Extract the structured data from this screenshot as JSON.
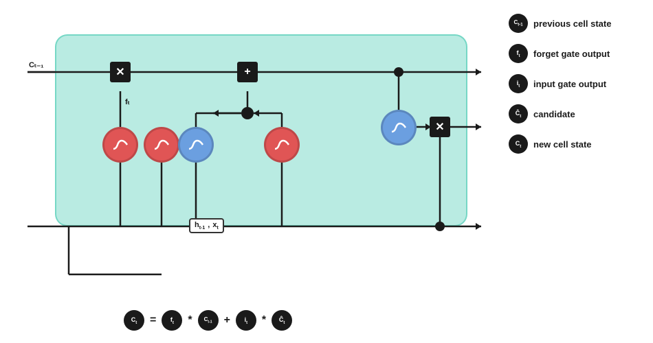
{
  "legend": {
    "items": [
      {
        "id": "c-prev",
        "symbol": "Cₜ₋₁",
        "label": "previous cell state",
        "subscript": "t-1"
      },
      {
        "id": "f",
        "symbol": "fₜ",
        "label": "forget gate output",
        "subscript": "t"
      },
      {
        "id": "i",
        "symbol": "iₜ",
        "label": "input gate output",
        "subscript": "t"
      },
      {
        "id": "c-candidate",
        "symbol": "Ċₜ",
        "label": "candidate",
        "subscript": "t"
      },
      {
        "id": "c-new",
        "symbol": "Cₜ",
        "label": "new cell state",
        "subscript": "t"
      }
    ]
  },
  "formula": {
    "parts": [
      {
        "type": "circle",
        "text": "Cₜ"
      },
      {
        "type": "text",
        "text": "="
      },
      {
        "type": "circle",
        "text": "fₜ"
      },
      {
        "type": "text",
        "text": "*"
      },
      {
        "type": "circle",
        "text": "Cₜ₋₁"
      },
      {
        "type": "text",
        "text": "+"
      },
      {
        "type": "circle",
        "text": "iₜ"
      },
      {
        "type": "text",
        "text": "*"
      },
      {
        "type": "circle",
        "text": "Ċₜ"
      }
    ]
  },
  "diagram": {
    "labels": {
      "c_prev": "Cₜ₋₁",
      "f_t": "fₜ",
      "h_prev": "hₜ₋₁",
      "x_t": "xₜ"
    }
  }
}
